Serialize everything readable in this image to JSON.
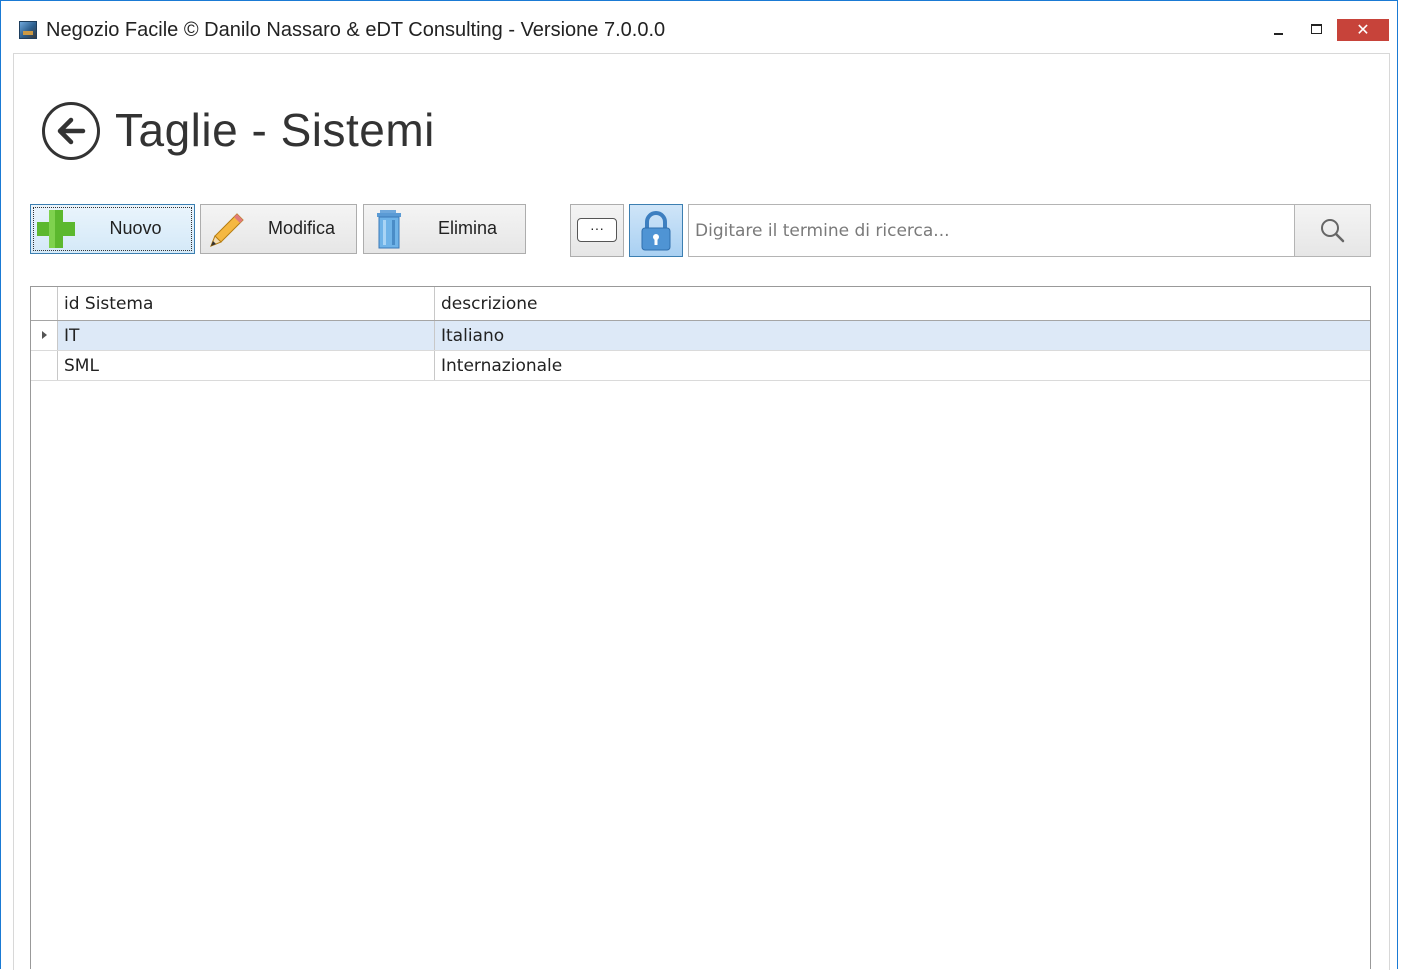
{
  "window": {
    "title": "Negozio Facile © Danilo Nassaro & eDT Consulting - Versione 7.0.0.0",
    "close_glyph": "✕",
    "accent_color": "#1a7ad4",
    "close_color": "#c7433a"
  },
  "page": {
    "title": "Taglie - Sistemi",
    "back_icon": "arrow-left-circle-icon"
  },
  "toolbar": {
    "new_label": "Nuovo",
    "edit_label": "Modifica",
    "delete_label": "Elimina",
    "more_label": "···",
    "icons": [
      "plus-icon",
      "pencil-icon",
      "trash-icon",
      "ellipsis-icon",
      "lock-icon",
      "search-icon"
    ]
  },
  "search": {
    "placeholder": "Digitare il termine di ricerca...",
    "value": ""
  },
  "grid": {
    "columns": [
      "id Sistema",
      "descrizione"
    ],
    "rows": [
      {
        "id": "IT",
        "descrizione": "Italiano",
        "selected": true
      },
      {
        "id": "SML",
        "descrizione": "Internazionale",
        "selected": false
      }
    ]
  }
}
